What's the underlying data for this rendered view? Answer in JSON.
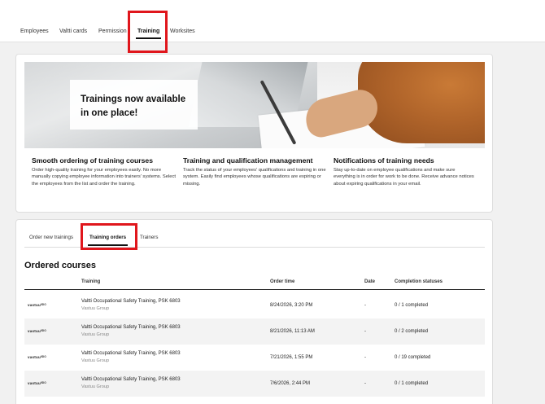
{
  "topnav": {
    "tabs": [
      {
        "label": "Employees"
      },
      {
        "label": "Valtti cards"
      },
      {
        "label": "Permission"
      },
      {
        "label": "Training"
      },
      {
        "label": "Worksites"
      }
    ],
    "active": "Training"
  },
  "hero": {
    "headline": "Trainings now available in one place!"
  },
  "features": [
    {
      "title": "Smooth ordering of training courses",
      "text": "Order high-quality training for your employees easily. No more manually copying employee information into trainers' systems. Select the employees from the list and order the training."
    },
    {
      "title": "Training and qualification management",
      "text": "Track the status of your employees' qualifications and training in one system. Easily find employees whose qualifications are expiring or missing."
    },
    {
      "title": "Notifications of training needs",
      "text": "Stay up-to-date on employee qualifications and make sure everything is in order for work to be done. Receive advance notices about expiring qualifications in your email."
    }
  ],
  "subtabs": [
    {
      "label": "Order new trainings"
    },
    {
      "label": "Training orders"
    },
    {
      "label": "Trainers"
    }
  ],
  "orders": {
    "title": "Ordered courses",
    "columns": {
      "training": "Training",
      "order_time": "Order time",
      "date": "Date",
      "status": "Completion statuses"
    },
    "rows": [
      {
        "logo": "vastuu⁰ᴰᴼ",
        "training": "Valtti Occupational Safety Training, PSK 6803",
        "org": "Vastuu Group",
        "order_time": "8/24/2026, 3:20 PM",
        "date": "-",
        "status": "0 / 1 completed"
      },
      {
        "logo": "vastuu⁰ᴰᴼ",
        "training": "Valtti Occupational Safety Training, PSK 6803",
        "org": "Vastuu Group",
        "order_time": "8/21/2026, 11:13 AM",
        "date": "-",
        "status": "0 / 2 completed"
      },
      {
        "logo": "vastuu⁰ᴰᴼ",
        "training": "Valtti Occupational Safety Training, PSK 6803",
        "org": "Vastuu Group",
        "order_time": "7/21/2026, 1:55 PM",
        "date": "-",
        "status": "0 / 19 completed"
      },
      {
        "logo": "vastuu⁰ᴰᴼ",
        "training": "Valtti Occupational Safety Training, PSK 6803",
        "org": "Vastuu Group",
        "order_time": "7/6/2026, 2:44 PM",
        "date": "-",
        "status": "0 / 1 completed"
      }
    ]
  },
  "colors": {
    "highlight": "#e0161c",
    "accent": "#111111",
    "alt_row": "#f3f3f3"
  }
}
